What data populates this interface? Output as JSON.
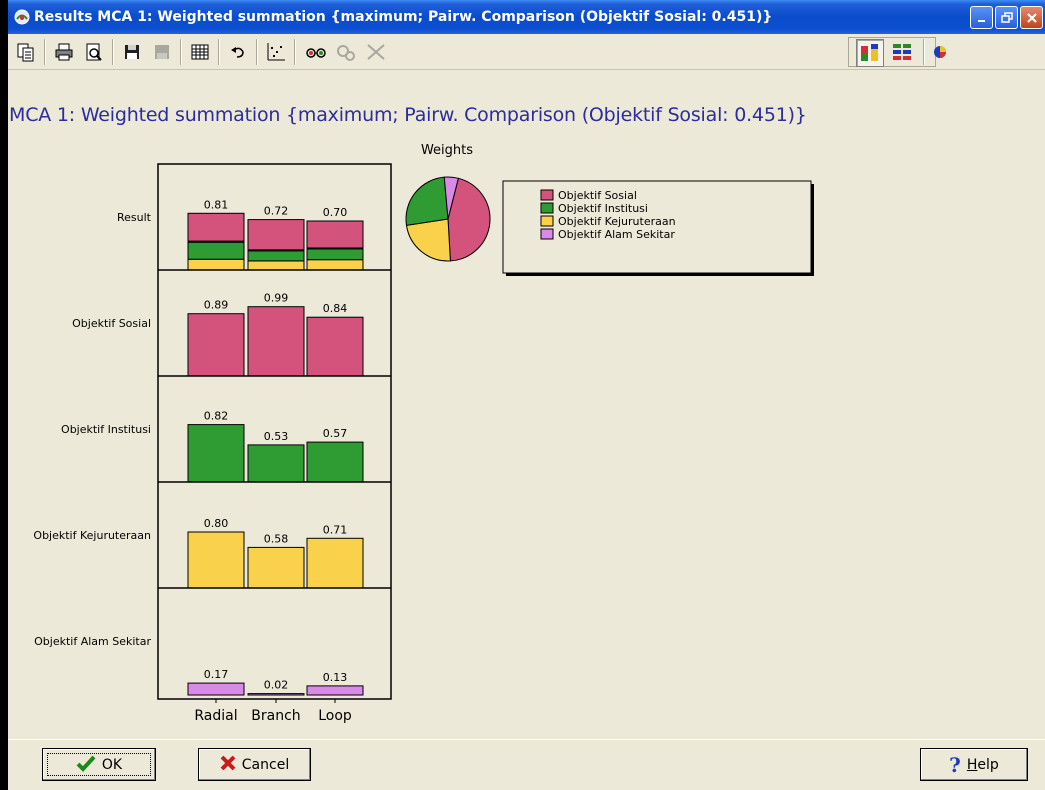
{
  "window": {
    "title": "Results MCA 1: Weighted summation {maximum; Pairw. Comparison (Objektif Sosial: 0.451)}",
    "heading": "MCA 1: Weighted summation {maximum; Pairw. Comparison (Objektif Sosial: 0.451)}"
  },
  "toolbar": {
    "icons": [
      "copy-icon",
      "print-icon",
      "print-preview-icon",
      "save-icon",
      "save-disabled-icon",
      "table-icon",
      "undo-icon",
      "scatter-icon",
      "glasses-icon",
      "settings-disabled-icon",
      "delete-disabled-icon",
      "stacked-bar-icon",
      "grouped-bar-icon",
      "pie-icon"
    ]
  },
  "colors": {
    "sosial": "#d4537c",
    "institusi": "#2e9b33",
    "kejuruteraan": "#f9d14b",
    "alam": "#d98ae8",
    "heading": "#2c2c9c"
  },
  "chart_data": {
    "type": "bar",
    "categories": [
      "Radial",
      "Branch",
      "Loop"
    ],
    "rows": [
      {
        "name": "Result",
        "values": [
          0.81,
          0.72,
          0.7
        ],
        "labels": [
          "0.81",
          "0.72",
          "0.70"
        ],
        "stacked": true
      },
      {
        "name": "Objektif Sosial",
        "values": [
          0.89,
          0.99,
          0.84
        ],
        "labels": [
          "0.89",
          "0.99",
          "0.84"
        ]
      },
      {
        "name": "Objektif Institusi",
        "values": [
          0.82,
          0.53,
          0.57
        ],
        "labels": [
          "0.82",
          "0.53",
          "0.57"
        ]
      },
      {
        "name": "Objektif Kejuruteraan",
        "values": [
          0.8,
          0.58,
          0.71
        ],
        "labels": [
          "0.80",
          "0.58",
          "0.71"
        ]
      },
      {
        "name": "Objektif Alam Sekitar",
        "values": [
          0.17,
          0.02,
          0.13
        ],
        "labels": [
          "0.17",
          "0.02",
          "0.13"
        ]
      }
    ],
    "result_stack_fractions": [
      {
        "sosial": 0.49,
        "institusi": 0.3,
        "kejuruteraan": 0.19,
        "alam": 0.02
      },
      {
        "sosial": 0.6,
        "institusi": 0.2,
        "kejuruteraan": 0.18,
        "alam": 0.02
      },
      {
        "sosial": 0.55,
        "institusi": 0.22,
        "kejuruteraan": 0.21,
        "alam": 0.02
      }
    ],
    "ylim": [
      0,
      1
    ],
    "weights": {
      "title": "Weights",
      "slices": [
        {
          "name": "Objektif Sosial",
          "value": 0.451,
          "color_key": "sosial"
        },
        {
          "name": "Objektif Kejuruteraan",
          "value": 0.235,
          "color_key": "kejuruteraan"
        },
        {
          "name": "Objektif Institusi",
          "value": 0.26,
          "color_key": "institusi"
        },
        {
          "name": "Objektif Alam Sekitar",
          "value": 0.054,
          "color_key": "alam"
        }
      ],
      "legend": [
        {
          "name": "Objektif Sosial",
          "color_key": "sosial"
        },
        {
          "name": "Objektif Institusi",
          "color_key": "institusi"
        },
        {
          "name": "Objektif Kejuruteraan",
          "color_key": "kejuruteraan"
        },
        {
          "name": "Objektif Alam Sekitar",
          "color_key": "alam"
        }
      ]
    }
  },
  "buttons": {
    "ok": "OK",
    "cancel": "Cancel",
    "help_prefix": "H",
    "help_rest": "elp"
  }
}
